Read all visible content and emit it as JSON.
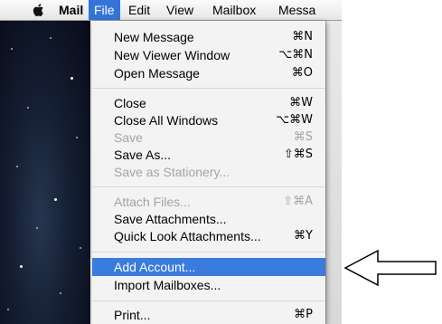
{
  "menubar": {
    "items": [
      {
        "label": "Mail"
      },
      {
        "label": "File"
      },
      {
        "label": "Edit"
      },
      {
        "label": "View"
      },
      {
        "label": "Mailbox"
      },
      {
        "label": "Messa"
      }
    ]
  },
  "file_menu": {
    "items": [
      {
        "label": "New Message",
        "shortcut": "⌘N",
        "enabled": true
      },
      {
        "label": "New Viewer Window",
        "shortcut": "⌥⌘N",
        "enabled": true
      },
      {
        "label": "Open Message",
        "shortcut": "⌘O",
        "enabled": true
      },
      {
        "label": "Close",
        "shortcut": "⌘W",
        "enabled": true
      },
      {
        "label": "Close All Windows",
        "shortcut": "⌥⌘W",
        "enabled": true
      },
      {
        "label": "Save",
        "shortcut": "⌘S",
        "enabled": false
      },
      {
        "label": "Save As...",
        "shortcut": "⇧⌘S",
        "enabled": true
      },
      {
        "label": "Save as Stationery...",
        "shortcut": "",
        "enabled": false
      },
      {
        "label": "Attach Files...",
        "shortcut": "⇧⌘A",
        "enabled": false
      },
      {
        "label": "Save Attachments...",
        "shortcut": "",
        "enabled": true
      },
      {
        "label": "Quick Look Attachments...",
        "shortcut": "⌘Y",
        "enabled": true
      },
      {
        "label": "Add Account...",
        "shortcut": "",
        "enabled": true,
        "highlighted": true
      },
      {
        "label": "Import Mailboxes...",
        "shortcut": "",
        "enabled": true
      },
      {
        "label": "Print...",
        "shortcut": "⌘P",
        "enabled": true
      }
    ]
  },
  "icons": {
    "apple_menu": "apple-logo-icon",
    "annotation": "outline-arrow-left-icon"
  },
  "colors": {
    "highlight": "#3a7be0",
    "menubar_active": "#3474d9",
    "disabled_text": "#a4a4a4"
  }
}
